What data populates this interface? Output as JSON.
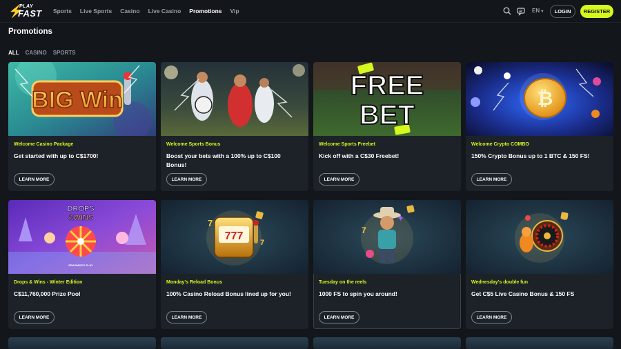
{
  "header": {
    "logo_top": "PLAY",
    "logo_bottom": "FAST",
    "nav": [
      "Sports",
      "Live Sports",
      "Casino",
      "Live Casino",
      "Promotions",
      "Vip"
    ],
    "active_nav": "Promotions",
    "language": "EN",
    "login_label": "LOGIN",
    "register_label": "REGISTER"
  },
  "page": {
    "title": "Promotions",
    "filters": [
      "ALL",
      "CASINO",
      "SPORTS"
    ],
    "active_filter": "ALL"
  },
  "cards": [
    {
      "tag": "Welcome Casino Package",
      "title": "Get started with up to C$1700!",
      "button": "LEARN MORE",
      "image": "big-win-slot-image",
      "image_text": "BIG Win"
    },
    {
      "tag": "Welcome Sports Bonus",
      "title": "Boost your bets with a 100% up to C$100 Bonus!",
      "button": "LEARN MORE",
      "image": "football-players-image"
    },
    {
      "tag": "Welcome Sports Freebet",
      "title": "Kick off with a C$30 Freebet!",
      "button": "LEARN MORE",
      "image": "free-bet-image",
      "image_text": [
        "FREE",
        "BET"
      ]
    },
    {
      "tag": "Welcome Crypto COMBO",
      "title": "150% Crypto Bonus up to 1 BTC & 150 FS!",
      "button": "LEARN MORE",
      "image": "bitcoin-coin-image"
    },
    {
      "tag": "Drops & Wins - Winter Edition",
      "title": "C$11,760,000 Prize Pool",
      "button": "LEARN MORE",
      "image": "drops-wins-image",
      "image_text": [
        "DROPS",
        "&WINS",
        "PRAGMATIC PLAY"
      ]
    },
    {
      "tag": "Monday's Reload Bonus",
      "title": "100% Casino Reload Bonus lined up for you!",
      "button": "LEARN MORE",
      "image": "slot-machine-image",
      "image_text": "777"
    },
    {
      "tag": "Tuesday on the reels",
      "title": "1000 FS to spin you around!",
      "button": "LEARN MORE",
      "image": "cowboy-character-image"
    },
    {
      "tag": "Wednesday's double fun",
      "title": "Get C$5 Live Casino Bonus & 150 FS",
      "button": "LEARN MORE",
      "image": "roulette-wheel-image"
    }
  ],
  "colors": {
    "accent": "#d5f81f",
    "background": "#13161b",
    "card": "#1d2229"
  }
}
